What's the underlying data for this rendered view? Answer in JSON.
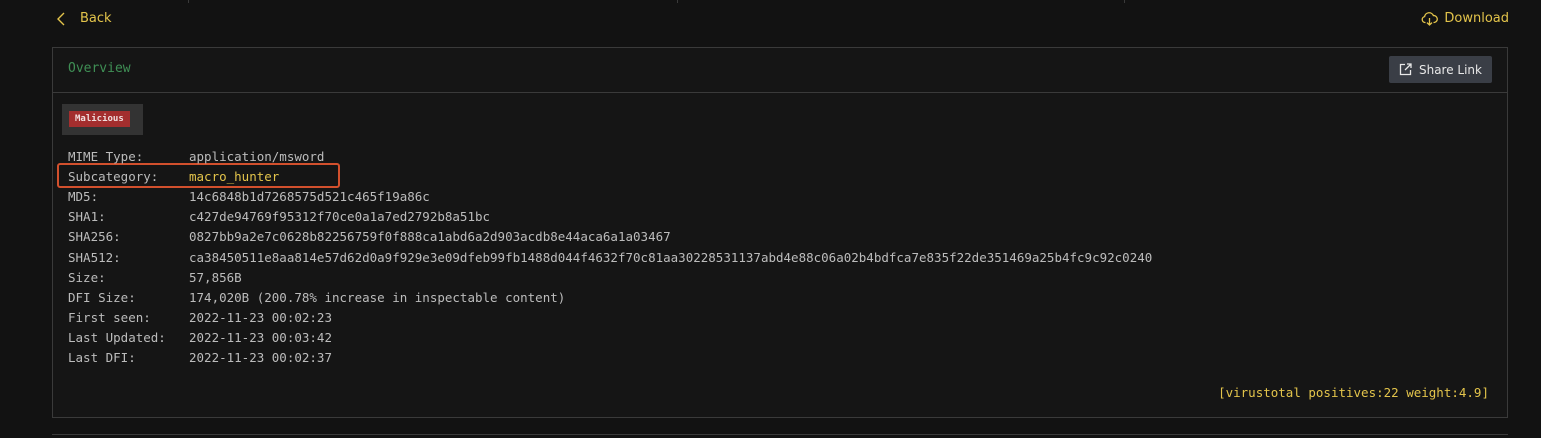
{
  "nav": {
    "back_label": "Back",
    "download_label": "Download"
  },
  "panel": {
    "title": "Overview",
    "share_label": "Share Link",
    "badge": "Malicious",
    "rows": [
      {
        "key": "MIME Type:",
        "value": "application/msword"
      },
      {
        "key": "Subcategory:",
        "value": "macro_hunter"
      },
      {
        "key": "MD5:",
        "value": "14c6848b1d7268575d521c465f19a86c"
      },
      {
        "key": "SHA1:",
        "value": "c427de94769f95312f70ce0a1a7ed2792b8a51bc"
      },
      {
        "key": "SHA256:",
        "value": "0827bb9a2e7c0628b82256759f0f888ca1abd6a2d903acdb8e44aca6a1a03467"
      },
      {
        "key": "SHA512:",
        "value": "ca38450511e8aa814e57d62d0a9f929e3e09dfeb99fb1488d044f4632f70c81aa30228531137abd4e88c06a02b4bdfca7e835f22de351469a25b4fc9c92c0240"
      },
      {
        "key": "Size:",
        "value": "57,856B"
      },
      {
        "key": "DFI Size:",
        "value": "174,020B (200.78% increase in inspectable content)"
      },
      {
        "key": "First seen:",
        "value": "2022-11-23 00:02:23"
      },
      {
        "key": "Last Updated:",
        "value": "2022-11-23 00:03:42"
      },
      {
        "key": "Last DFI:",
        "value": "2022-11-23 00:02:37"
      }
    ],
    "virustotal": "[virustotal positives:22 weight:4.9]"
  },
  "colors": {
    "accent": "#e3c44b",
    "title_green": "#3f8f55",
    "badge_red": "#a32e2e",
    "highlight_border": "#d2502d"
  }
}
